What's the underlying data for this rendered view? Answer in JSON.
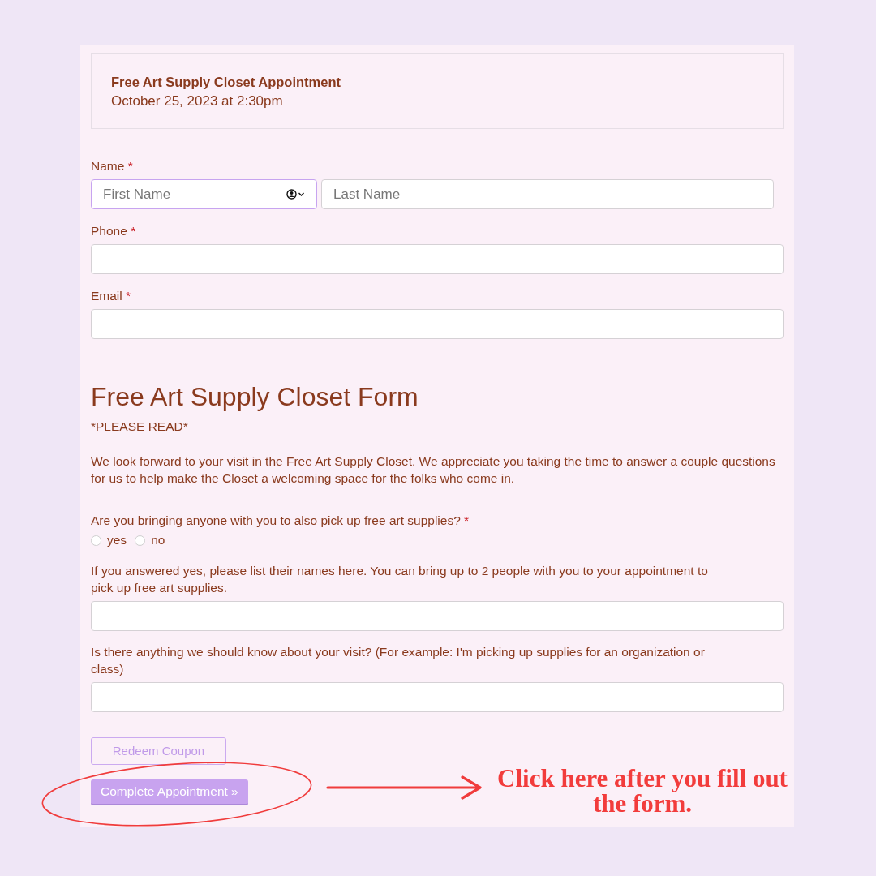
{
  "appointment": {
    "title": "Free Art Supply Closet Appointment",
    "date": "October 25, 2023 at 2:30pm"
  },
  "contact_fields": [
    {
      "kind": "name",
      "label": "Name",
      "required_mark": "*",
      "inputs": [
        {
          "placeholder": "First Name",
          "focused": true,
          "autofill": true
        },
        {
          "placeholder": "Last Name",
          "focused": false,
          "autofill": false
        }
      ]
    },
    {
      "kind": "text",
      "label": "Phone",
      "required_mark": "*",
      "inputs": [
        {
          "focused": false,
          "autofill": false
        }
      ]
    },
    {
      "kind": "text",
      "label": "Email",
      "required_mark": "*",
      "inputs": [
        {
          "focused": false,
          "autofill": false
        }
      ]
    }
  ],
  "form": {
    "title": "Free Art Supply Closet Form",
    "notice": "*PLEASE READ*",
    "intro": "We look forward to your visit in the Free Art Supply Closet. We appreciate you taking the time to answer a couple questions for us to help make the Closet a welcoming space for the folks who come in.",
    "questions": [
      {
        "kind": "radio",
        "label": "Are you bringing anyone with you to also pick up free art supplies?",
        "required_mark": "*",
        "options": [
          {
            "label": "yes",
            "selected": false
          },
          {
            "label": "no",
            "selected": false
          }
        ]
      },
      {
        "kind": "text",
        "label": "If you answered yes, please list their names here. You can bring up to 2 people with you to your appointment to pick up free art supplies."
      },
      {
        "kind": "text",
        "label": "Is there anything we should know about your visit? (For example: I'm picking up supplies for an organization or class)"
      }
    ]
  },
  "buttons": [
    {
      "kind": "outline",
      "label": "Redeem Coupon"
    },
    {
      "kind": "primary",
      "label": "Complete Appointment »"
    }
  ],
  "annotation": {
    "text": "Click here after you fill out the form."
  }
}
